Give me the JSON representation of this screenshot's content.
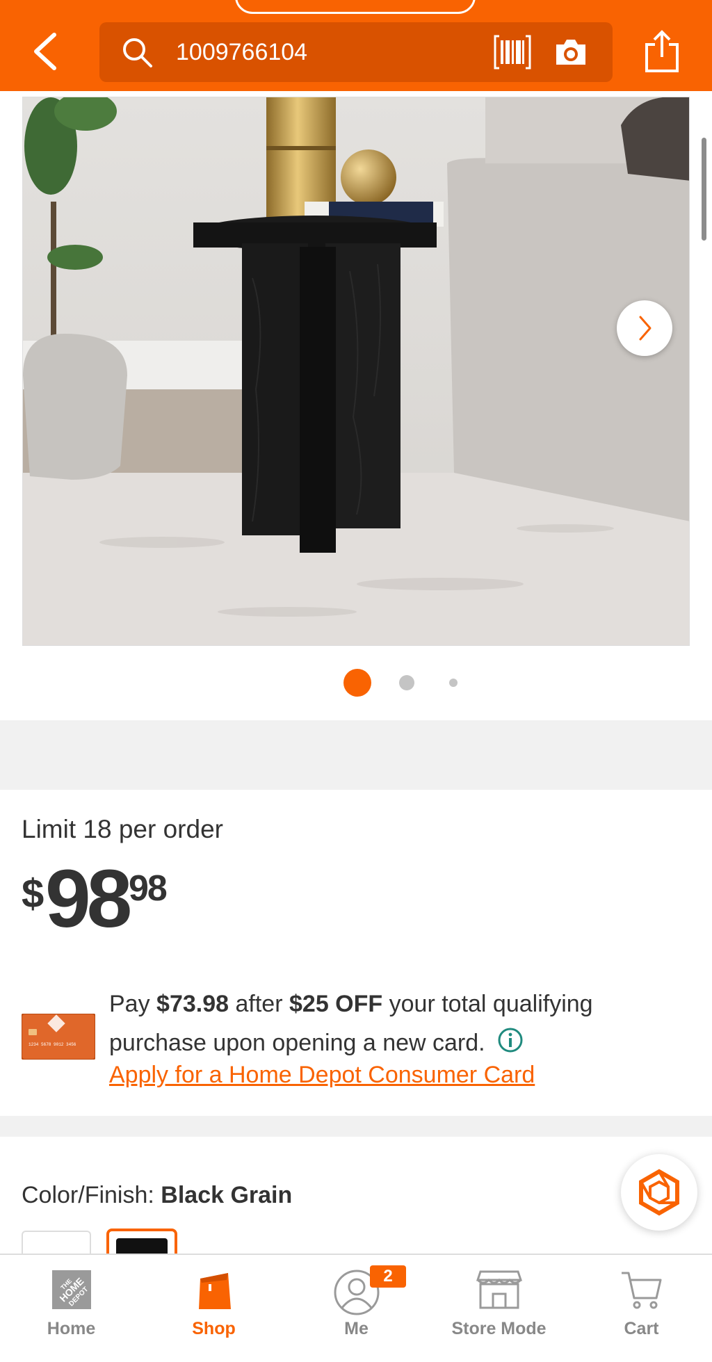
{
  "header": {
    "search_value": "1009766104",
    "colors": {
      "brand": "#f96302",
      "search_bg": "#d95200"
    },
    "icons": [
      "back-arrow-icon",
      "search-icon",
      "barcode-scan-icon",
      "camera-icon",
      "share-icon"
    ]
  },
  "gallery": {
    "image_description": "Black grain round end table beside a gray sofa on a shaggy rug",
    "page_count": 3,
    "active_page": 1
  },
  "pricing": {
    "limit_text": "Limit 18 per order",
    "currency": "$",
    "dollars": "98",
    "cents": "98"
  },
  "promo": {
    "pay": "Pay",
    "discounted_price": "$73.98",
    "after": "after",
    "discount": "$25 OFF",
    "rest_line1": "your total qualifying",
    "line2": "purchase upon opening a new card.",
    "apply_link": "Apply for a Home Depot Consumer Card",
    "card_number": "1234 5678 9012 3456"
  },
  "color_finish": {
    "label": "Color/Finish:",
    "value": "Black Grain"
  },
  "tabbar": {
    "tabs": [
      {
        "label": "Home",
        "icon": "home-depot-logo-icon",
        "active": false
      },
      {
        "label": "Shop",
        "icon": "shop-bag-icon",
        "active": true
      },
      {
        "label": "Me",
        "icon": "person-icon",
        "active": false,
        "badge": "2"
      },
      {
        "label": "Store Mode",
        "icon": "store-icon",
        "active": false
      },
      {
        "label": "Cart",
        "icon": "cart-icon",
        "active": false
      }
    ]
  }
}
